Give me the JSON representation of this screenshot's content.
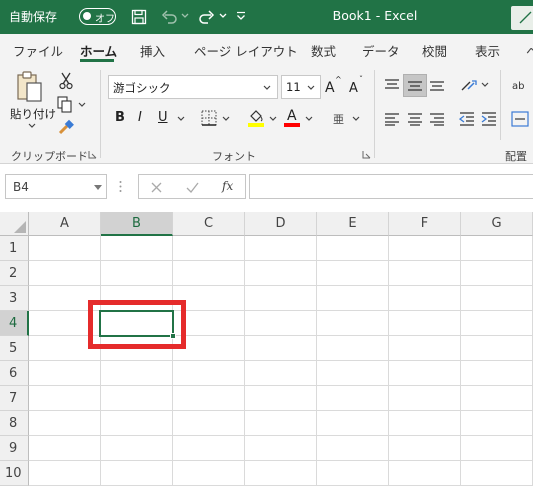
{
  "titlebar": {
    "autosave_label": "自動保存",
    "autosave_state": "オフ",
    "doc_title": "Book1  -  Excel"
  },
  "tabs": [
    "ファイル",
    "ホーム",
    "挿入",
    "ページ レイアウト",
    "数式",
    "データ",
    "校閲",
    "表示"
  ],
  "ribbon": {
    "clipboard": {
      "paste_label": "貼り付け",
      "group_label": "クリップボード"
    },
    "font": {
      "font_name": "游ゴシック",
      "font_size": "11",
      "group_label": "フォント",
      "bold": "B",
      "italic": "I",
      "underline": "U",
      "grow": "A",
      "shrink": "A",
      "font_color_letter": "A",
      "phonetic": "亜"
    },
    "alignment": {
      "group_label": "配置"
    }
  },
  "formula_bar": {
    "name_box": "B4",
    "fx": "fx",
    "formula": ""
  },
  "grid": {
    "columns": [
      "A",
      "B",
      "C",
      "D",
      "E",
      "F",
      "G"
    ],
    "rows": [
      "1",
      "2",
      "3",
      "4",
      "5",
      "6",
      "7",
      "8",
      "9",
      "10"
    ],
    "selected_cell": "B4"
  },
  "colors": {
    "accent": "#217346",
    "highlight_yellow": "#ffff00",
    "font_red": "#ff0000",
    "annotation_red": "#e52b2b"
  }
}
